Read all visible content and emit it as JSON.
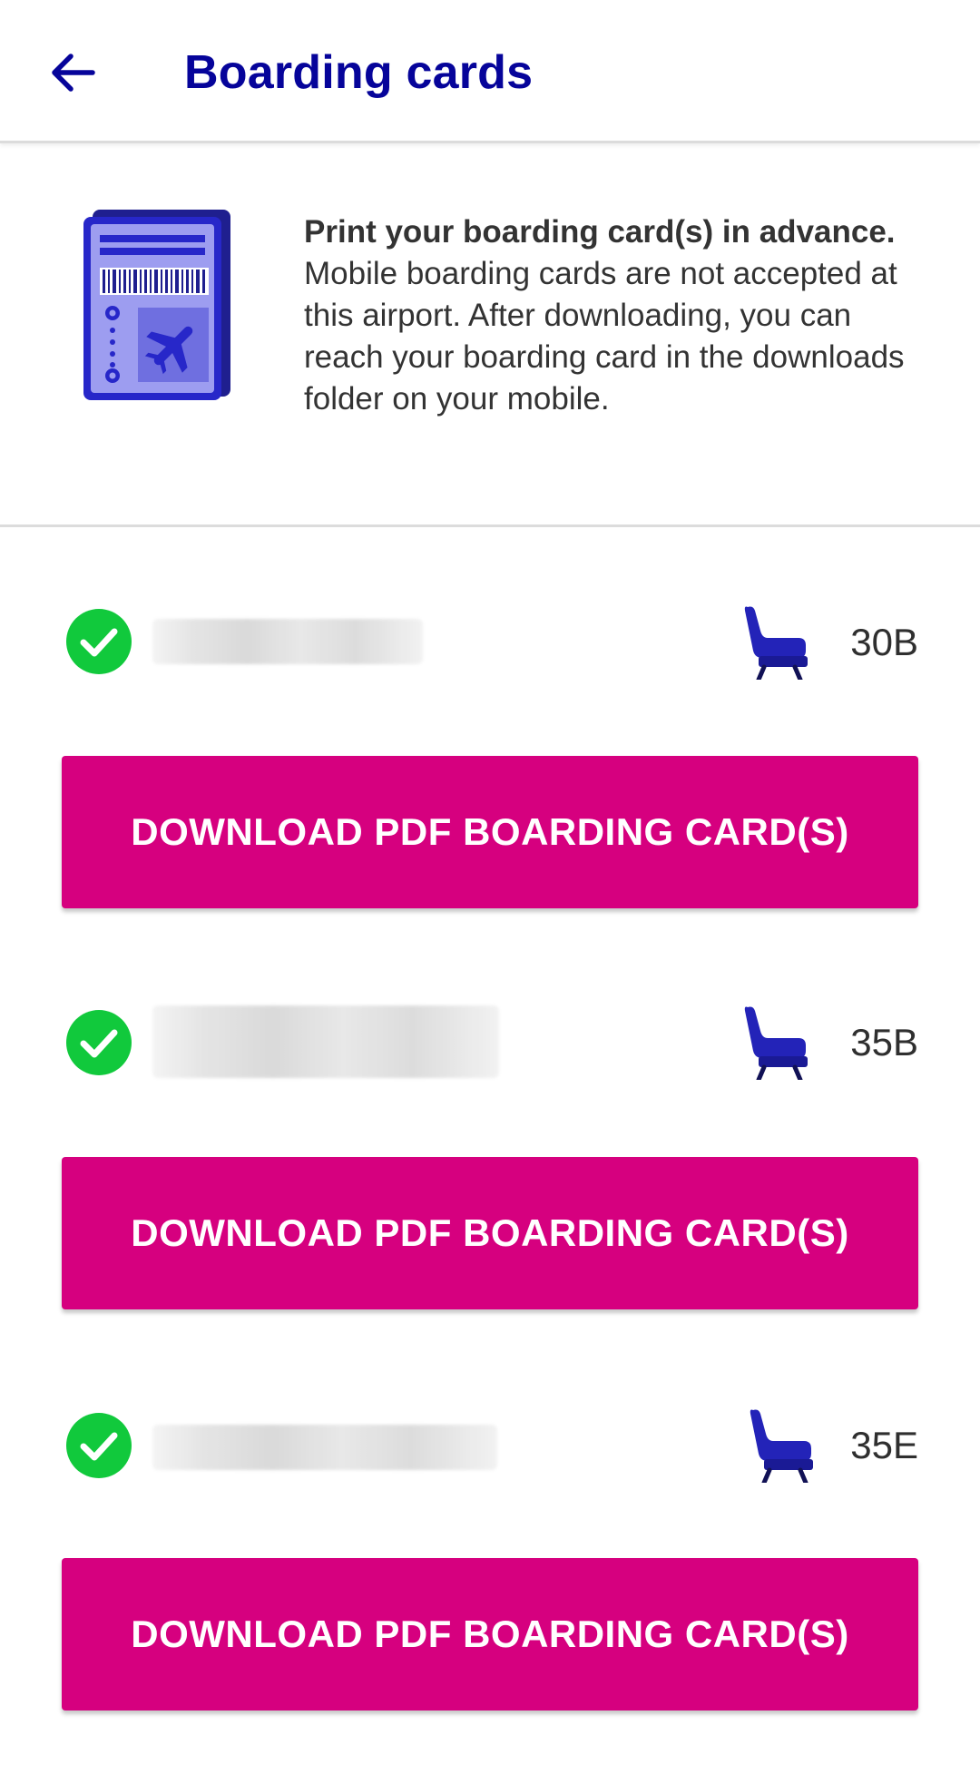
{
  "header": {
    "title": "Boarding cards",
    "back_icon": "arrow-left-icon"
  },
  "info": {
    "illustration_icon": "boarding-card-illustration",
    "bold_text": "Print your boarding card(s) in advance.",
    "body_text": " Mobile boarding cards are not accepted at this airport. After downloading, you can reach your boarding card in the downloads folder on your mobile."
  },
  "passengers": [
    {
      "status_icon": "check-circle-icon",
      "seat_icon": "seat-icon",
      "seat": "30B",
      "download_label": "DOWNLOAD PDF BOARDING CARD(S)"
    },
    {
      "status_icon": "check-circle-icon",
      "seat_icon": "seat-icon",
      "seat": "35B",
      "download_label": "DOWNLOAD PDF BOARDING CARD(S)"
    },
    {
      "status_icon": "check-circle-icon",
      "seat_icon": "seat-icon",
      "seat": "35E",
      "download_label": "DOWNLOAD PDF BOARDING CARD(S)"
    }
  ],
  "colors": {
    "brand_blue": "#06049a",
    "brand_magenta": "#d6007f",
    "success_green": "#11c93c"
  }
}
